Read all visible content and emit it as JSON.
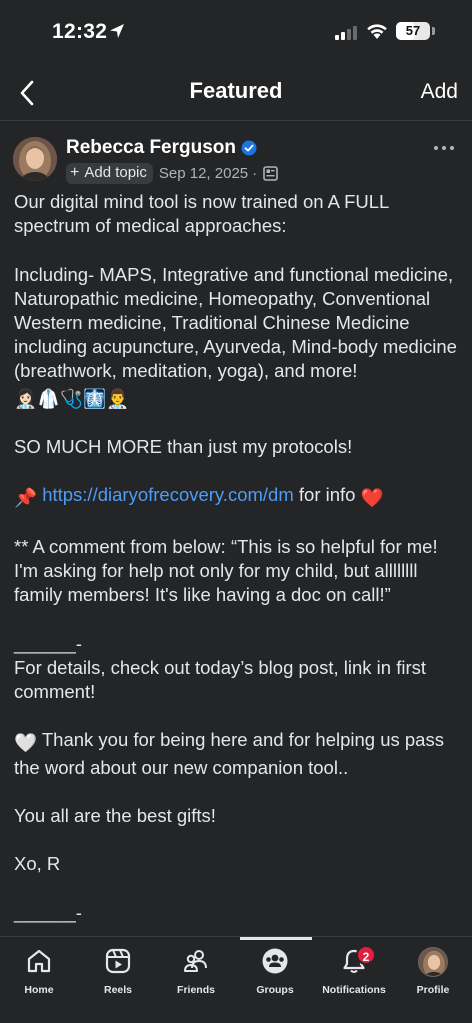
{
  "status_bar": {
    "time": "12:32",
    "battery": "57",
    "battery_fraction": 0.57
  },
  "header": {
    "back_icon": "chevron-left-icon",
    "title": "Featured",
    "add_label": "Add"
  },
  "post": {
    "author": "Rebecca Ferguson",
    "add_topic_label": "Add topic",
    "date": "Sep 12, 2025",
    "meta_separator": "·",
    "lines": {
      "l1": "Our digital mind tool is now trained on A FULL spectrum of medical approaches:",
      "l2": "Including- MAPS, Integrative and functional medicine, Naturopathic medicine, Homeopathy, Conventional Western medicine, Traditional Chinese Medicine including acupuncture, Ayurveda, Mind-body medicine (breathwork, meditation, yoga), and more!",
      "l2_emoji": "👩🏻‍⚕️🥼🩺🩻👨‍⚕️",
      "l3": "SO MUCH MORE than just my protocols!",
      "l4_pin": "📌",
      "l4_link": "https://diaryofrecovery.com/dm",
      "l4_after": " for info ",
      "l4_heart": "❤️",
      "l5": "** A comment from below: “This is so helpful for me! I'm asking for help not only for my child, but allllllll family members! It's like having a doc on call!”",
      "l6": "______-",
      "l7": "For details, check out today’s blog post, link in first comment!",
      "l8_heart": "🤍",
      "l8": " Thank you for being here and for helping us pass the word about our new companion tool..",
      "l9": "You all are the best gifts!",
      "l10": "Xo, R",
      "l11": "______-"
    }
  },
  "tabs": {
    "home": "Home",
    "reels": "Reels",
    "friends": "Friends",
    "groups": "Groups",
    "notifications": "Notifications",
    "notifications_badge": "2",
    "profile": "Profile",
    "active": "Groups"
  },
  "colors": {
    "background": "#242526",
    "link": "#4f9cf7",
    "verified": "#1b74e4",
    "badge": "#e41e3f"
  }
}
